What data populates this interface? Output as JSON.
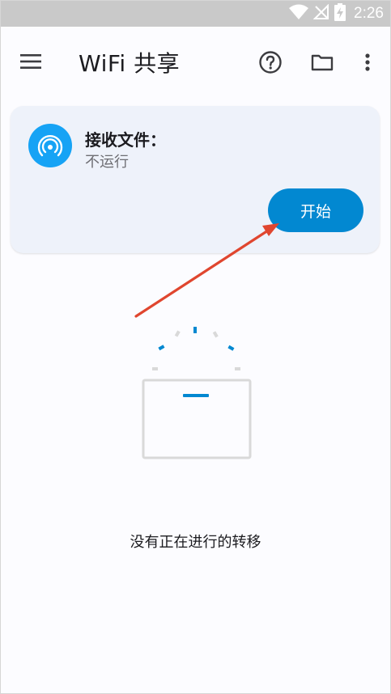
{
  "status_bar": {
    "time": "2:26",
    "icons": [
      "wifi-icon",
      "no-signal-icon",
      "battery-charging-icon"
    ]
  },
  "app_bar": {
    "title": "WiFi 共享",
    "actions": [
      "menu-icon",
      "help-icon",
      "folder-icon",
      "more-vert-icon"
    ]
  },
  "receive_card": {
    "icon": "wifi-tethering-icon",
    "title": "接收文件：",
    "status": "不运行",
    "button_label": "开始"
  },
  "empty_state": {
    "icon": "empty-box-icon",
    "message": "没有正在进行的转移"
  },
  "colors": {
    "accent": "#0288d1",
    "avatar": "#16a3f5",
    "card_bg": "#eef2fa",
    "annotation_arrow": "#e0462f",
    "status_bar": "#c9c9c9"
  }
}
